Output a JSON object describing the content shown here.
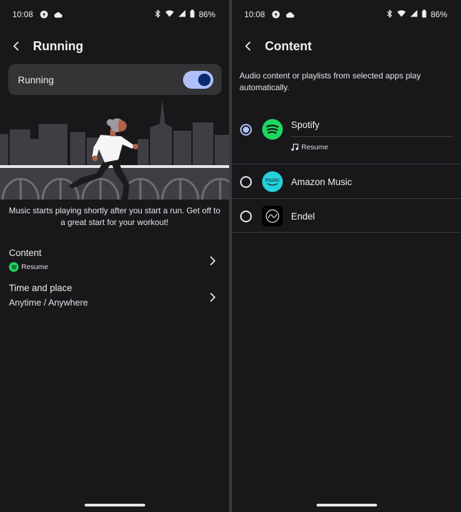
{
  "left": {
    "status": {
      "time": "10:08",
      "battery": "86%"
    },
    "title": "Running",
    "toggle": {
      "label": "Running",
      "on": true
    },
    "description": "Music starts playing shortly after you start a run. Get off to a great start for your workout!",
    "settings": [
      {
        "title": "Content",
        "subtitle": "Resume",
        "icon": "spotify-icon"
      },
      {
        "title": "Time and place",
        "subtitle": "Anytime / Anywhere"
      }
    ]
  },
  "right": {
    "status": {
      "time": "10:08",
      "battery": "86%"
    },
    "title": "Content",
    "description": "Audio content or playlists from selected apps play automatically.",
    "apps": [
      {
        "name": "Spotify",
        "selected": true,
        "sub_label": "Resume",
        "icon": "spotify-icon",
        "color": "#1ed760"
      },
      {
        "name": "Amazon Music",
        "selected": false,
        "icon_text": "music",
        "icon": "amazon-music-icon",
        "color": "#25d1da"
      },
      {
        "name": "Endel",
        "selected": false,
        "icon": "endel-icon",
        "color": "#000000"
      }
    ]
  },
  "colors": {
    "background": "#18181b",
    "card": "#343437",
    "switch_track": "#aebffa",
    "switch_knob": "#0c2a6e",
    "radio_selected": "#b3c2f8"
  }
}
